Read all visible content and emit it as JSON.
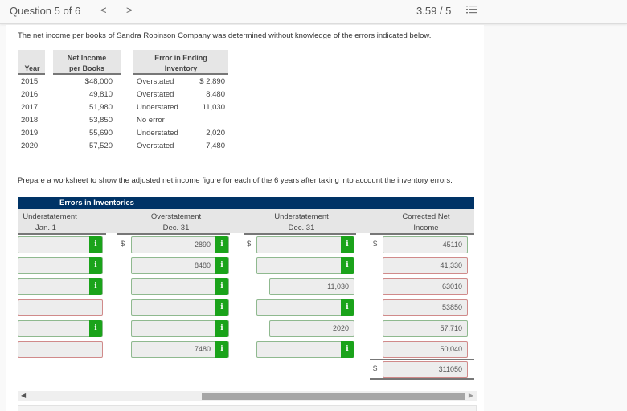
{
  "header": {
    "question_label": "Question 5 of 6",
    "prev_icon": "chevron-left-icon",
    "prev_glyph": "<",
    "next_icon": "chevron-right-icon",
    "next_glyph": ">",
    "score": "3.59 / 5",
    "list_icon": "list-icon"
  },
  "problem": {
    "intro": "The net income per books of Sandra Robinson Company was determined without knowledge of the errors indicated below.",
    "table": {
      "headers": {
        "year": "Year",
        "net_income_l1": "Net Income",
        "net_income_l2": "per Books",
        "error_l1": "Error in Ending",
        "error_l2": "Inventory"
      },
      "rows": [
        {
          "year": "2015",
          "net_income": "$48,000",
          "error_type": "Overstated",
          "error_amount": "$ 2,890"
        },
        {
          "year": "2016",
          "net_income": "49,810",
          "error_type": "Overstated",
          "error_amount": "8,480"
        },
        {
          "year": "2017",
          "net_income": "51,980",
          "error_type": "Understated",
          "error_amount": "11,030"
        },
        {
          "year": "2018",
          "net_income": "53,850",
          "error_type": "No error",
          "error_amount": ""
        },
        {
          "year": "2019",
          "net_income": "55,690",
          "error_type": "Understated",
          "error_amount": "2,020"
        },
        {
          "year": "2020",
          "net_income": "57,520",
          "error_type": "Overstated",
          "error_amount": "7,480"
        }
      ]
    },
    "prepare": "Prepare a worksheet to show the adjusted net income figure for each of the 6 years after taking into account the inventory errors."
  },
  "worksheet": {
    "band_title": "Errors in Inventories",
    "columns": {
      "under_jan_l1": "Understatement",
      "under_jan_l2": "Jan. 1",
      "over_dec_l1": "Overstatement",
      "over_dec_l2": "Dec. 31",
      "under_dec_l1": "Understatement",
      "under_dec_l2": "Dec. 31",
      "corrected_l1": "Corrected Net",
      "corrected_l2": "Income"
    },
    "currency": "$",
    "info_glyph": "i",
    "rows": [
      {
        "under_jan": "",
        "under_jan_status": "ok",
        "under_jan_info": true,
        "over_dec": "2890",
        "over_dec_status": "ok",
        "over_dec_info": true,
        "under_dec": "",
        "under_dec_status": "ok",
        "under_dec_info": true,
        "corrected": "45110",
        "corrected_status": "ok"
      },
      {
        "under_jan": "",
        "under_jan_status": "ok",
        "under_jan_info": true,
        "over_dec": "8480",
        "over_dec_status": "ok",
        "over_dec_info": true,
        "under_dec": "",
        "under_dec_status": "ok",
        "under_dec_info": true,
        "corrected": "41,330",
        "corrected_status": "bad"
      },
      {
        "under_jan": "",
        "under_jan_status": "ok",
        "under_jan_info": true,
        "over_dec": "",
        "over_dec_status": "ok",
        "over_dec_info": true,
        "under_dec": "11,030",
        "under_dec_status": "ok",
        "under_dec_info": false,
        "corrected": "63010",
        "corrected_status": "bad"
      },
      {
        "under_jan": "",
        "under_jan_status": "bad",
        "under_jan_info": false,
        "over_dec": "",
        "over_dec_status": "ok",
        "over_dec_info": true,
        "under_dec": "",
        "under_dec_status": "ok",
        "under_dec_info": true,
        "corrected": "53850",
        "corrected_status": "bad"
      },
      {
        "under_jan": "",
        "under_jan_status": "ok",
        "under_jan_info": true,
        "over_dec": "",
        "over_dec_status": "ok",
        "over_dec_info": true,
        "under_dec": "2020",
        "under_dec_status": "ok",
        "under_dec_info": false,
        "corrected": "57,710",
        "corrected_status": "ok"
      },
      {
        "under_jan": "",
        "under_jan_status": "bad",
        "under_jan_info": false,
        "over_dec": "7480",
        "over_dec_status": "ok",
        "over_dec_info": true,
        "under_dec": "",
        "under_dec_status": "ok",
        "under_dec_info": true,
        "corrected": "50,040",
        "corrected_status": "bad"
      }
    ],
    "total": {
      "value": "311050",
      "status": "bad"
    }
  },
  "scrollbar": {
    "left_glyph": "◀",
    "right_glyph": "▶"
  },
  "colors": {
    "band": "#003366",
    "info_button": "#1aa31a",
    "correct_border": "#8fb98f",
    "incorrect_border": "#d08a8a"
  }
}
